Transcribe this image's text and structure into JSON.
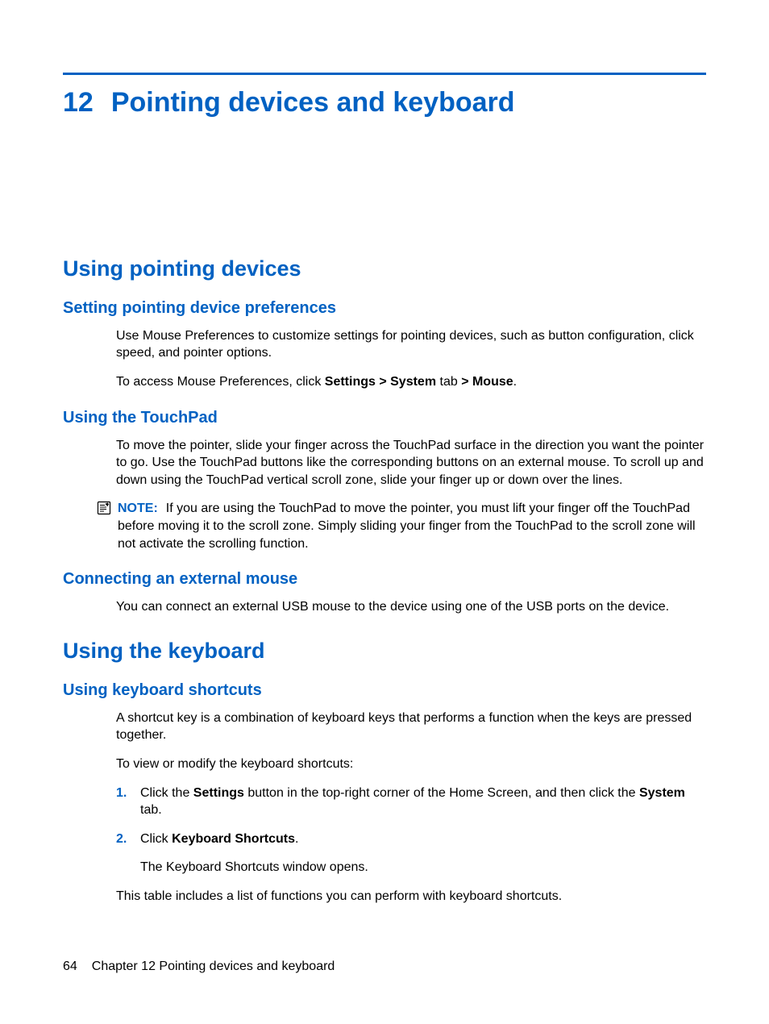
{
  "chapter": {
    "number": "12",
    "title": "Pointing devices and keyboard"
  },
  "sections": {
    "usingPointing": {
      "heading": "Using pointing devices",
      "prefs": {
        "heading": "Setting pointing device preferences",
        "p1": "Use Mouse Preferences to customize settings for pointing devices, such as button configuration, click speed, and pointer options.",
        "p2_pre": "To access Mouse Preferences, click ",
        "p2_bold1": "Settings > System",
        "p2_mid": " tab ",
        "p2_bold2": "> Mouse",
        "p2_post": "."
      },
      "touchpad": {
        "heading": "Using the TouchPad",
        "p1": "To move the pointer, slide your finger across the TouchPad surface in the direction you want the pointer to go. Use the TouchPad buttons like the corresponding buttons on an external mouse. To scroll up and down using the TouchPad vertical scroll zone, slide your finger up or down over the lines.",
        "note_label": "NOTE:",
        "note_text": "If you are using the TouchPad to move the pointer, you must lift your finger off the TouchPad before moving it to the scroll zone. Simply sliding your finger from the TouchPad to the scroll zone will not activate the scrolling function."
      },
      "extmouse": {
        "heading": "Connecting an external mouse",
        "p1": "You can connect an external USB mouse to the device using one of the USB ports on the device."
      }
    },
    "usingKeyboard": {
      "heading": "Using the keyboard",
      "shortcuts": {
        "heading": "Using keyboard shortcuts",
        "p1": "A shortcut key is a combination of keyboard keys that performs a function when the keys are pressed together.",
        "p2": "To view or modify the keyboard shortcuts:",
        "step1_num": "1.",
        "step1_pre": "Click the ",
        "step1_b1": "Settings",
        "step1_mid": " button in the top-right corner of the Home Screen, and then click the ",
        "step1_b2": "System",
        "step1_post": " tab.",
        "step2_num": "2.",
        "step2_pre": "Click ",
        "step2_b1": "Keyboard Shortcuts",
        "step2_post": ".",
        "step2_sub": "The Keyboard Shortcuts window opens.",
        "p3": "This table includes a list of functions you can perform with keyboard shortcuts."
      }
    }
  },
  "footer": {
    "page": "64",
    "label": "Chapter 12   Pointing devices and keyboard"
  }
}
